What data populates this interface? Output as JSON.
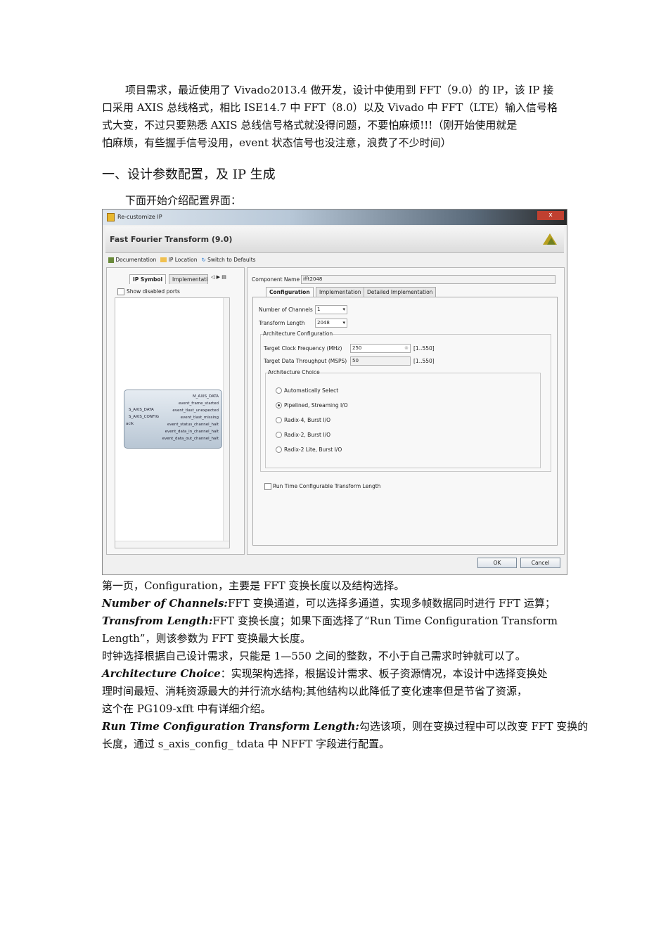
{
  "intro_lines": [
    "项目需求，最近使用了 Vivado2013.4 做开发，设计中使用到 FFT（9.0）的 IP，该 IP 接",
    "口采用 AXIS 总线格式，相比 ISE14.7 中 FFT（8.0）以及 Vivado 中 FFT（LTE）输入信号格",
    "式大变，不过只要熟悉 AXIS 总线信号格式就没得问题，不要怕麻烦!!!（刚开始使用就是",
    "怕麻烦，有些握手信号没用，event 状态信号也没注意，浪费了不少时间）"
  ],
  "heading": "一、设计参数配置，及 IP 生成",
  "intro2": "下面开始介绍配置界面：",
  "dialog": {
    "window_title": "Re-customize IP",
    "ip_title": "Fast Fourier Transform (9.0)",
    "toolbar": {
      "documentation": "Documentation",
      "ip_location": "IP Location",
      "switch_defaults": "Switch to Defaults"
    },
    "left_tabs": [
      "IP Symbol",
      "Implementati"
    ],
    "show_disabled_ports": "Show disabled ports",
    "symbol_ports_left": [
      "S_AXIS_DATA",
      "S_AXIS_CONFIG",
      "aclk"
    ],
    "symbol_ports_right": [
      "M_AXIS_DATA",
      "event_frame_started",
      "event_tlast_unexpected",
      "event_tlast_missing",
      "event_status_channel_halt",
      "event_data_in_channel_halt",
      "event_data_out_channel_halt"
    ],
    "component_name_label": "Component Name",
    "component_name": "ifft2048",
    "tabs": [
      "Configuration",
      "Implementation",
      "Detailed Implementation"
    ],
    "num_channels_label": "Number of Channels",
    "num_channels": "1",
    "transform_length_label": "Transform Length",
    "transform_length": "2048",
    "arch_config_label": "Architecture Configuration",
    "clock_label": "Target Clock Frequency (MHz)",
    "clock": "250",
    "clock_range": "[1..550]",
    "throughput_label": "Target Data Throughput (MSPS)",
    "throughput": "50",
    "throughput_range": "[1..550]",
    "arch_choice_label": "Architecture Choice",
    "arch_options": [
      "Automatically Select",
      "Pipelined, Streaming I/O",
      "Radix-4, Burst I/O",
      "Radix-2, Burst I/O",
      "Radix-2 Lite, Burst I/O"
    ],
    "arch_selected": 1,
    "runtime_label": "Run Time Configurable Transform Length",
    "ok": "OK",
    "cancel": "Cancel"
  },
  "body": {
    "l1": "第一页，Configuration，主要是 FFT 变换长度以及结构选择。",
    "l2a": "Number of Channels:",
    "l2b": "FFT 变换通道，可以选择多通道，实现多帧数据同时进行 FFT 运算；",
    "l3a": "Transfrom  Length:",
    "l3b": "FFT  变换长度；如果下面选择了“Run  Time  Configuration  Transform",
    "l4": "Length”，则该参数为 FFT 变换最大长度。",
    "l5": "时钟选择根据自己设计需求，只能是 1—550 之间的整数，不小于自己需求时钟就可以了。",
    "l6a": "Architecture  Choice",
    "l6b": "：实现架构选择，根据设计需求、板子资源情况，本设计中选择变换处",
    "l7": "理时间最短、消耗资源最大的并行流水结构;其他结构以此降低了变化速率但是节省了资源，",
    "l8": "这个在 PG109-xfft 中有详细介绍。",
    "l9a": "Run Time Configuration Transform Length:",
    "l9b": "勾选该项，则在变换过程中可以改变 FFT 变换的",
    "l10": "长度，通过 s_axis_config_ tdata 中 NFFT 字段进行配置。"
  }
}
